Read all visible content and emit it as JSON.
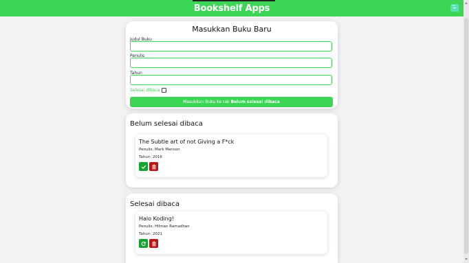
{
  "app": {
    "title": "Bookshelf Apps"
  },
  "form": {
    "heading": "Masukkan Buku Baru",
    "fields": [
      {
        "label": "Judul Buku",
        "value": ""
      },
      {
        "label": "Penulis",
        "value": ""
      },
      {
        "label": "Tahun",
        "value": ""
      }
    ],
    "checkbox_label": "Selesai dibaca",
    "submit_prefix": "Masukkan Buku ke rak",
    "submit_shelf": "Belum selesai dibaca"
  },
  "shelves": {
    "unread": {
      "heading": "Belum selesai dibaca",
      "books": [
        {
          "title": "The Subtle art of not Giving a F*ck",
          "author": "Penulis: Mark Manson",
          "year": "Tahun: 2016"
        }
      ]
    },
    "read": {
      "heading": "Selesai dibaca",
      "books": [
        {
          "title": "Halo Koding!",
          "author": "Penulis: Hilman Ramadhan",
          "year": "Tahun: 2021"
        }
      ]
    }
  },
  "colors": {
    "accent": "#3dd556",
    "done": "#16a331",
    "delete": "#b71515"
  },
  "icons": {
    "done": "check-icon",
    "undo": "refresh-icon",
    "delete": "trash-icon",
    "corner": "translate-icon"
  }
}
